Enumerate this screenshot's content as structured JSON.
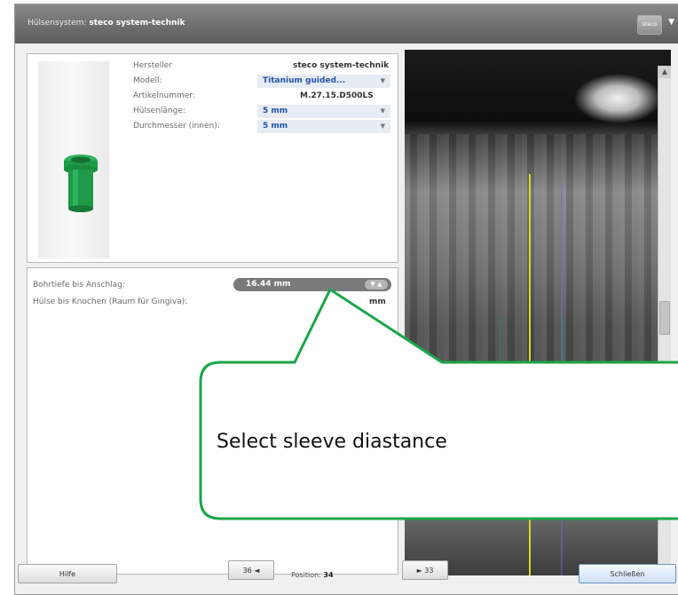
{
  "titlebar": {
    "prefix": "Hülsensystem:",
    "system": "steco system-technik",
    "logo_text": "steco",
    "dropdown_arrow": "▼"
  },
  "properties": [
    {
      "key": "Hersteller",
      "value": "steco system-technik",
      "type": "plain"
    },
    {
      "key": "Modell:",
      "value": "Titanium guided...",
      "type": "select"
    },
    {
      "key": "Artikelnummer:",
      "value": "M.27.15.D500LS",
      "type": "plain"
    },
    {
      "key": "Hülsenlänge:",
      "value": "5 mm",
      "type": "select"
    },
    {
      "key": "Durchmesser (innen):",
      "value": "5 mm",
      "type": "select"
    }
  ],
  "drill": {
    "depth_label": "Bohrtiefe bis Anschlag:",
    "depth_value": "16.44 mm",
    "sleeve_bone_label": "Hülse bis Knochen (Raum für Gingiva):",
    "sleeve_bone_value": "mm"
  },
  "footer": {
    "help": "Hilfe",
    "prev": "36 ◄",
    "position_label": "Position:",
    "position_value": "34",
    "next": "► 33",
    "close": "Schließen"
  },
  "callout": {
    "text": "Select sleeve diastance",
    "border_color": "#1aa64a"
  },
  "colors": {
    "sleeve_green": "#1f9a48",
    "guide_line": "#d8d820"
  }
}
